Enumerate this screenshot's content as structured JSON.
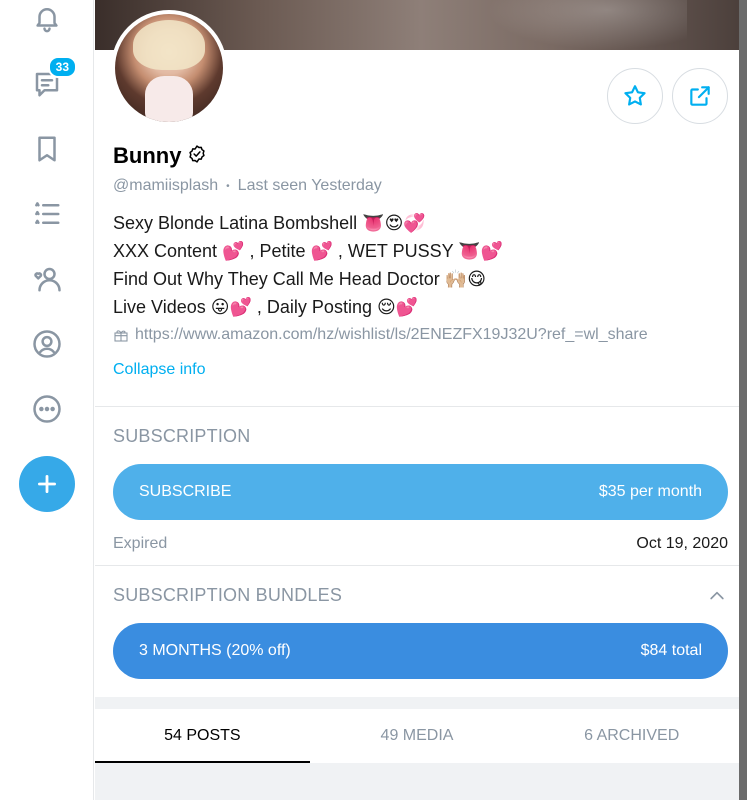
{
  "rail": {
    "messages_badge": "33",
    "icons": [
      "bell-icon",
      "messages-icon",
      "bookmark-icon",
      "lists-icon",
      "subscriptions-icon",
      "profile-icon",
      "more-icon",
      "add-icon"
    ]
  },
  "profile": {
    "name": "Bunny",
    "handle": "@mamiisplash",
    "separator": "•",
    "last_seen": "Last seen Yesterday",
    "bio_lines": [
      "Sexy Blonde Latina Bombshell 👅😍💞",
      "XXX Content 💕 , Petite 💕 , WET PUSSY 👅💕",
      "Find Out Why They Call Me Head Doctor 🙌🏼😋",
      "Live Videos 😛💕 , Daily Posting 😌💕"
    ],
    "wishlist_url": "https://www.amazon.com/hz/wishlist/ls/2ENEZFX19J32U?ref_=wl_share",
    "collapse_label": "Collapse info"
  },
  "subscription": {
    "title": "SUBSCRIPTION",
    "button_label": "SUBSCRIBE",
    "price": "$35 per month",
    "expired_label": "Expired",
    "expired_date": "Oct 19, 2020"
  },
  "bundles": {
    "title": "SUBSCRIPTION BUNDLES",
    "bundle_label": "3 MONTHS (20% off)",
    "bundle_price": "$84 total"
  },
  "tabs": [
    {
      "label": "54 POSTS",
      "active": true
    },
    {
      "label": "49 MEDIA",
      "active": false
    },
    {
      "label": "6 ARCHIVED",
      "active": false
    }
  ],
  "colors": {
    "accent": "#00aff0",
    "subscribe_button": "#4fb0ea",
    "bundle_button": "#3a8de0",
    "muted_text": "#8a96a3"
  }
}
